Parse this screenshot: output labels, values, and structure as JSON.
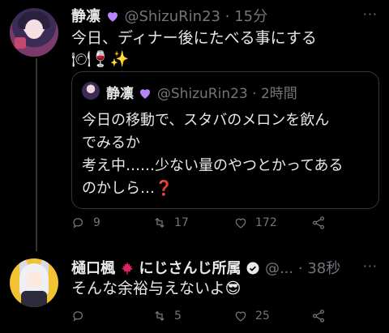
{
  "colors": {
    "background": "#000000",
    "text": "#e7e9ea",
    "muted": "#71767b",
    "border": "#333639",
    "heart_purple": "#b983ff",
    "maple_red": "#e0245e"
  },
  "tweet1": {
    "name": "静凛",
    "handle": "@ShizuRin23",
    "dot": "·",
    "time": "15分",
    "more": "···",
    "line1": "今日、ディナー後にたべる事にする",
    "line2_emojis": "🍽🍷✨",
    "quote": {
      "name": "静凛",
      "handle": "@ShizuRin23",
      "dot": "·",
      "time": "2時間",
      "lines": [
        "今日の移動で、スタバのメロンを飲ん",
        "でみるか",
        "考え中……少ない量のやつとかってある",
        "のかしら…"
      ],
      "question_emoji": "❓"
    },
    "actions": {
      "reply_count": "9",
      "retweet_count": "17",
      "like_count": "172"
    }
  },
  "tweet2": {
    "name": "樋口楓",
    "org": "にじさんじ所属",
    "handle": "@...",
    "dot": "·",
    "time": "38秒",
    "more": "···",
    "text": "そんな余裕与えないよ",
    "emoji": "😎",
    "actions": {
      "reply_count": "",
      "retweet_count": "5",
      "like_count": "25"
    }
  }
}
